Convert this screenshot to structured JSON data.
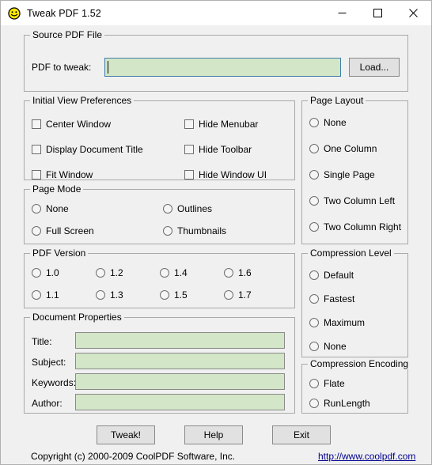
{
  "window": {
    "title": "Tweak PDF 1.52",
    "icon": "smiley-face-icon",
    "controls": {
      "minimize": "minimize-icon",
      "maximize": "maximize-icon",
      "close": "close-icon"
    }
  },
  "source_group": {
    "legend": "Source PDF File",
    "field_label": "PDF to tweak:",
    "field_value": "",
    "field_placeholder": "",
    "load_button": "Load..."
  },
  "initial_view": {
    "legend": "Initial View Preferences",
    "left_items": [
      {
        "label": "Center Window",
        "checked": false
      },
      {
        "label": "Display Document Title",
        "checked": false
      },
      {
        "label": "Fit Window",
        "checked": false
      }
    ],
    "right_items": [
      {
        "label": "Hide Menubar",
        "checked": false
      },
      {
        "label": "Hide Toolbar",
        "checked": false
      },
      {
        "label": "Hide Window UI",
        "checked": false
      }
    ]
  },
  "page_mode": {
    "legend": "Page Mode",
    "left_items": [
      {
        "label": "None",
        "selected": false
      },
      {
        "label": "Full Screen",
        "selected": false
      }
    ],
    "right_items": [
      {
        "label": "Outlines",
        "selected": false
      },
      {
        "label": "Thumbnails",
        "selected": false
      }
    ]
  },
  "pdf_version": {
    "legend": "PDF Version",
    "row1": [
      {
        "label": "1.0",
        "selected": false
      },
      {
        "label": "1.2",
        "selected": false
      },
      {
        "label": "1.4",
        "selected": false
      },
      {
        "label": "1.6",
        "selected": false
      }
    ],
    "row2": [
      {
        "label": "1.1",
        "selected": false
      },
      {
        "label": "1.3",
        "selected": false
      },
      {
        "label": "1.5",
        "selected": false
      },
      {
        "label": "1.7",
        "selected": false
      }
    ]
  },
  "document_properties": {
    "legend": "Document Properties",
    "fields": [
      {
        "label": "Title:",
        "value": ""
      },
      {
        "label": "Subject:",
        "value": ""
      },
      {
        "label": "Keywords:",
        "value": ""
      },
      {
        "label": "Author:",
        "value": ""
      }
    ]
  },
  "page_layout": {
    "legend": "Page Layout",
    "items": [
      {
        "label": "None",
        "selected": false
      },
      {
        "label": "One Column",
        "selected": false
      },
      {
        "label": "Single Page",
        "selected": false
      },
      {
        "label": "Two Column Left",
        "selected": false
      },
      {
        "label": "Two Column Right",
        "selected": false
      }
    ]
  },
  "compression_level": {
    "legend": "Compression Level",
    "items": [
      {
        "label": "Default",
        "selected": false
      },
      {
        "label": "Fastest",
        "selected": false
      },
      {
        "label": "Maximum",
        "selected": false
      },
      {
        "label": "None",
        "selected": false
      }
    ]
  },
  "compression_encoding": {
    "legend": "Compression Encoding",
    "items": [
      {
        "label": "Flate",
        "selected": false
      },
      {
        "label": "RunLength",
        "selected": false
      }
    ]
  },
  "actions": {
    "tweak": "Tweak!",
    "help": "Help",
    "exit": "Exit"
  },
  "footer": {
    "copyright": "Copyright (c) 2000-2009 CoolPDF Software, Inc.",
    "link": "http://www.coolpdf.com"
  },
  "colors": {
    "field_fill": "#d3e6c7",
    "field_focus_border": "#3f7fa5",
    "window_bg": "#f0f0f0",
    "link": "#00008f",
    "icon_yellow": "#ffe900"
  }
}
